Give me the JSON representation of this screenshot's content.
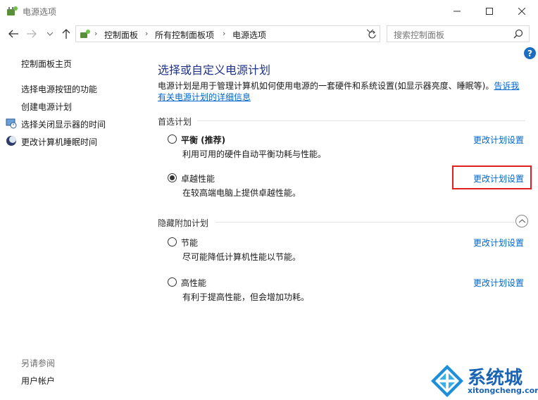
{
  "window": {
    "title": "电源选项"
  },
  "addressbar": {
    "crumbs": [
      "控制面板",
      "所有控制面板项",
      "电源选项"
    ]
  },
  "search": {
    "placeholder": "搜索控制面板"
  },
  "sidebar": {
    "items": [
      {
        "label": "控制面板主页"
      },
      {
        "label": "选择电源按钮的功能"
      },
      {
        "label": "创建电源计划"
      },
      {
        "label": "选择关闭显示器的时间",
        "icon": "monitor-clock-icon"
      },
      {
        "label": "更改计算机睡眠时间",
        "icon": "moon-icon"
      }
    ],
    "see_also_title": "另请参阅",
    "see_also_items": [
      {
        "label": "用户帐户"
      }
    ]
  },
  "main": {
    "title": "选择或自定义电源计划",
    "description": "电源计划是用于管理计算机如何使用电源的一套硬件和系统设置(如显示器亮度、睡眠等)。",
    "learn_more": "告诉我有关电源计划的详细信息",
    "preferred_group": {
      "heading": "首选计划",
      "plans": [
        {
          "name": "平衡 (推荐)",
          "desc": "利用可用的硬件自动平衡功耗与性能。",
          "selected": false,
          "change": "更改计划设置"
        },
        {
          "name": "卓越性能",
          "desc": "在较高端电脑上提供卓越性能。",
          "selected": true,
          "change": "更改计划设置"
        }
      ]
    },
    "hidden_group": {
      "heading": "隐藏附加计划",
      "plans": [
        {
          "name": "节能",
          "desc": "尽可能降低计算机性能以节能。",
          "selected": false,
          "change": "更改计划设置"
        },
        {
          "name": "高性能",
          "desc": "有利于提高性能，但会增加功耗。",
          "selected": false,
          "change": "更改计划设置"
        }
      ]
    }
  },
  "watermark": {
    "brand": "系统城",
    "url": "xitongcheng.com"
  },
  "colors": {
    "link": "#0066cc",
    "title": "#1e3287",
    "highlight": "#e02020",
    "brand": "#1b64b4"
  }
}
